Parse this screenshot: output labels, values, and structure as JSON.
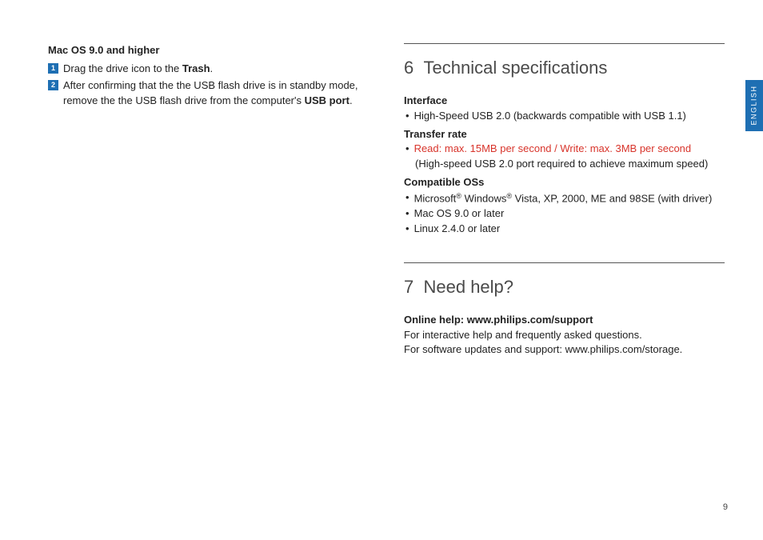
{
  "left": {
    "heading": "Mac OS 9.0 and higher",
    "steps": [
      {
        "num": "1",
        "pre": "Drag the drive icon to the ",
        "bold": "Trash",
        "post": "."
      },
      {
        "num": "2",
        "pre": "After confirming that the the USB flash drive is in standby mode, remove the the USB flash drive from the computer's ",
        "bold": "USB port",
        "post": "."
      }
    ]
  },
  "sec6": {
    "num": "6",
    "title": "Technical specifications",
    "interface_label": "Interface",
    "interface_text": "High-Speed USB 2.0 (backwards compatible with USB 1.1)",
    "transfer_label": "Transfer rate",
    "transfer_red": "Read: max. 15MB per second / Write: max. 3MB per second",
    "transfer_note": "(High-speed USB 2.0 port required to achieve maximum speed)",
    "os_label": "Compatible OSs",
    "os_item1_pre": "Microsoft",
    "os_item1_mid": " Windows",
    "os_item1_post": " Vista, XP, 2000, ME and 98SE (with driver)",
    "os_item2": "Mac OS 9.0 or later",
    "os_item3": "Linux 2.4.0 or later"
  },
  "sec7": {
    "num": "7",
    "title": "Need help?",
    "help_label": "Online help: www.philips.com/support",
    "line1": "For interactive help and frequently asked questions.",
    "line2": "For software updates and support: www.philips.com/storage."
  },
  "lang": "ENGLISH",
  "page": "9",
  "reg": "®"
}
